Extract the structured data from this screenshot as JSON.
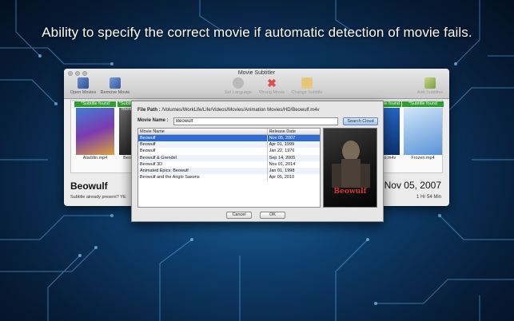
{
  "headline": "Ability to specify the correct movie if automatic detection of movie fails.",
  "window": {
    "title": "Movie Subtitler",
    "toolbar": {
      "open_movies": "Open Movies",
      "remove_movie": "Remove Movie",
      "set_language": "Set Language",
      "wrong_movie": "Wrong Movie",
      "change_subtitle": "Change Subtitle",
      "add_subtitles": "Add Subtitles"
    },
    "cards": [
      {
        "status": "*Subtitle found",
        "name": "Aladdin.mp4"
      },
      {
        "status": "*Subtitle found",
        "name": "Beo"
      },
      {
        "status": "*Subtitle found",
        "name": "Nemo.m4v"
      },
      {
        "status": "*Subtitle found",
        "name": "Frozen.mp4"
      }
    ],
    "movie_title": "Beowulf",
    "movie_date": "Nov 05, 2007",
    "subtitle_present": "Subtitle already present? YE",
    "duration": "1 Hr 54 Min"
  },
  "dialog": {
    "file_path_label": "File Path :",
    "file_path": "/Volumes/WorkLife/Life/Videos/Movies/Animation Movies/HD/Beowulf.m4v",
    "movie_name_label": "Movie Name :",
    "movie_name_value": "Beowulf",
    "search_button": "Search Cloud",
    "columns": [
      "Movie Name",
      "Release Date"
    ],
    "rows": [
      {
        "name": "Beowulf",
        "date": "Nov 05, 2007"
      },
      {
        "name": "Beowulf",
        "date": "Apr 01, 1999"
      },
      {
        "name": "Beowulf",
        "date": "Jan 22, 1976"
      },
      {
        "name": "Beowulf & Grendel",
        "date": "Sep 14, 2005"
      },
      {
        "name": "Beowulf 3D",
        "date": "Nov 01, 2014"
      },
      {
        "name": "Animated Epics: Beowulf",
        "date": "Jan 01, 1998"
      },
      {
        "name": "Beowulf and the Anglo Saxons",
        "date": "Apr 05, 2010"
      }
    ],
    "poster_title": "Beowulf",
    "cancel_button": "Cancel",
    "ok_button": "OK"
  }
}
